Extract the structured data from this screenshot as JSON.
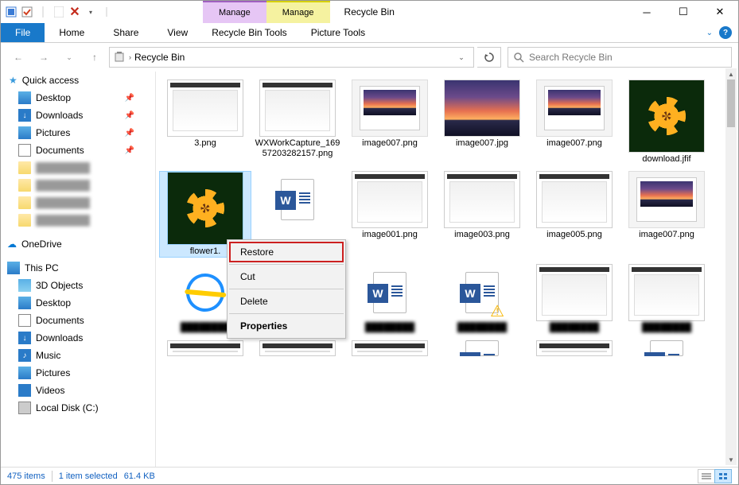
{
  "window": {
    "title": "Recycle Bin",
    "qat": {
      "has_delete": true
    }
  },
  "ribbon": {
    "context_tabs": [
      {
        "group": "Manage",
        "sub": "Recycle Bin Tools"
      },
      {
        "group": "Manage",
        "sub": "Picture Tools"
      }
    ],
    "file_tab": "File",
    "tabs": [
      "Home",
      "Share",
      "View"
    ]
  },
  "address": {
    "location": "Recycle Bin",
    "search_placeholder": "Search Recycle Bin"
  },
  "sidebar": {
    "quick_access": {
      "label": "Quick access"
    },
    "quick_items": [
      {
        "label": "Desktop",
        "pinned": true,
        "icon": "desktop"
      },
      {
        "label": "Downloads",
        "pinned": true,
        "icon": "downloads"
      },
      {
        "label": "Pictures",
        "pinned": true,
        "icon": "pictures"
      },
      {
        "label": "Documents",
        "pinned": true,
        "icon": "documents"
      }
    ],
    "blurred_folders": [
      "xxxxx",
      "xxxxx",
      "xxxxx",
      "xxxxx"
    ],
    "onedrive": "OneDrive",
    "thispc": {
      "label": "This PC"
    },
    "pc_items": [
      {
        "label": "3D Objects"
      },
      {
        "label": "Desktop"
      },
      {
        "label": "Documents"
      },
      {
        "label": "Downloads"
      },
      {
        "label": "Music"
      },
      {
        "label": "Pictures"
      },
      {
        "label": "Videos"
      },
      {
        "label": "Local Disk (C:)"
      }
    ]
  },
  "files": {
    "row1": [
      {
        "name": "3.png",
        "type": "screenshot"
      },
      {
        "name": "WXWorkCapture_16957203282157.png",
        "type": "screenshot"
      },
      {
        "name": "image007.png",
        "type": "sunset-window"
      },
      {
        "name": "image007.jpg",
        "type": "sunset"
      },
      {
        "name": "image007.png",
        "type": "sunset-window"
      },
      {
        "name": "download.jfif",
        "type": "flower-tall"
      }
    ],
    "row2": [
      {
        "name": "flower1.",
        "type": "flower-tall",
        "selected": true
      },
      {
        "name": "",
        "type": "word"
      },
      {
        "name": "image001.png",
        "type": "screenshot-red"
      },
      {
        "name": "image003.png",
        "type": "screenshot-blue"
      },
      {
        "name": "image005.png",
        "type": "screenshot-red"
      },
      {
        "name": "image007.png",
        "type": "sunset-window"
      }
    ],
    "row3": [
      {
        "name": "blurred",
        "type": "ie",
        "blurred": true
      },
      {
        "name": "blurred",
        "type": "folder",
        "blurred": true
      },
      {
        "name": "blurred",
        "type": "word",
        "blurred": true
      },
      {
        "name": "blurred",
        "type": "word-warn",
        "blurred": true
      },
      {
        "name": "blurred",
        "type": "screenshot",
        "blurred": true
      },
      {
        "name": "blurred",
        "type": "screenshot",
        "blurred": true
      }
    ],
    "row4_partial": [
      {
        "type": "screenshot"
      },
      {
        "type": "screenshot"
      },
      {
        "type": "screenshot"
      },
      {
        "type": "word"
      },
      {
        "type": "screenshot"
      },
      {
        "type": "word"
      }
    ]
  },
  "context_menu": {
    "items": [
      {
        "label": "Restore",
        "highlighted": true
      },
      {
        "label": "Cut"
      },
      {
        "label": "Delete"
      },
      {
        "label": "Properties",
        "bold": true
      }
    ]
  },
  "status": {
    "count": "475 items",
    "selection": "1 item selected",
    "size": "61.4 KB"
  }
}
